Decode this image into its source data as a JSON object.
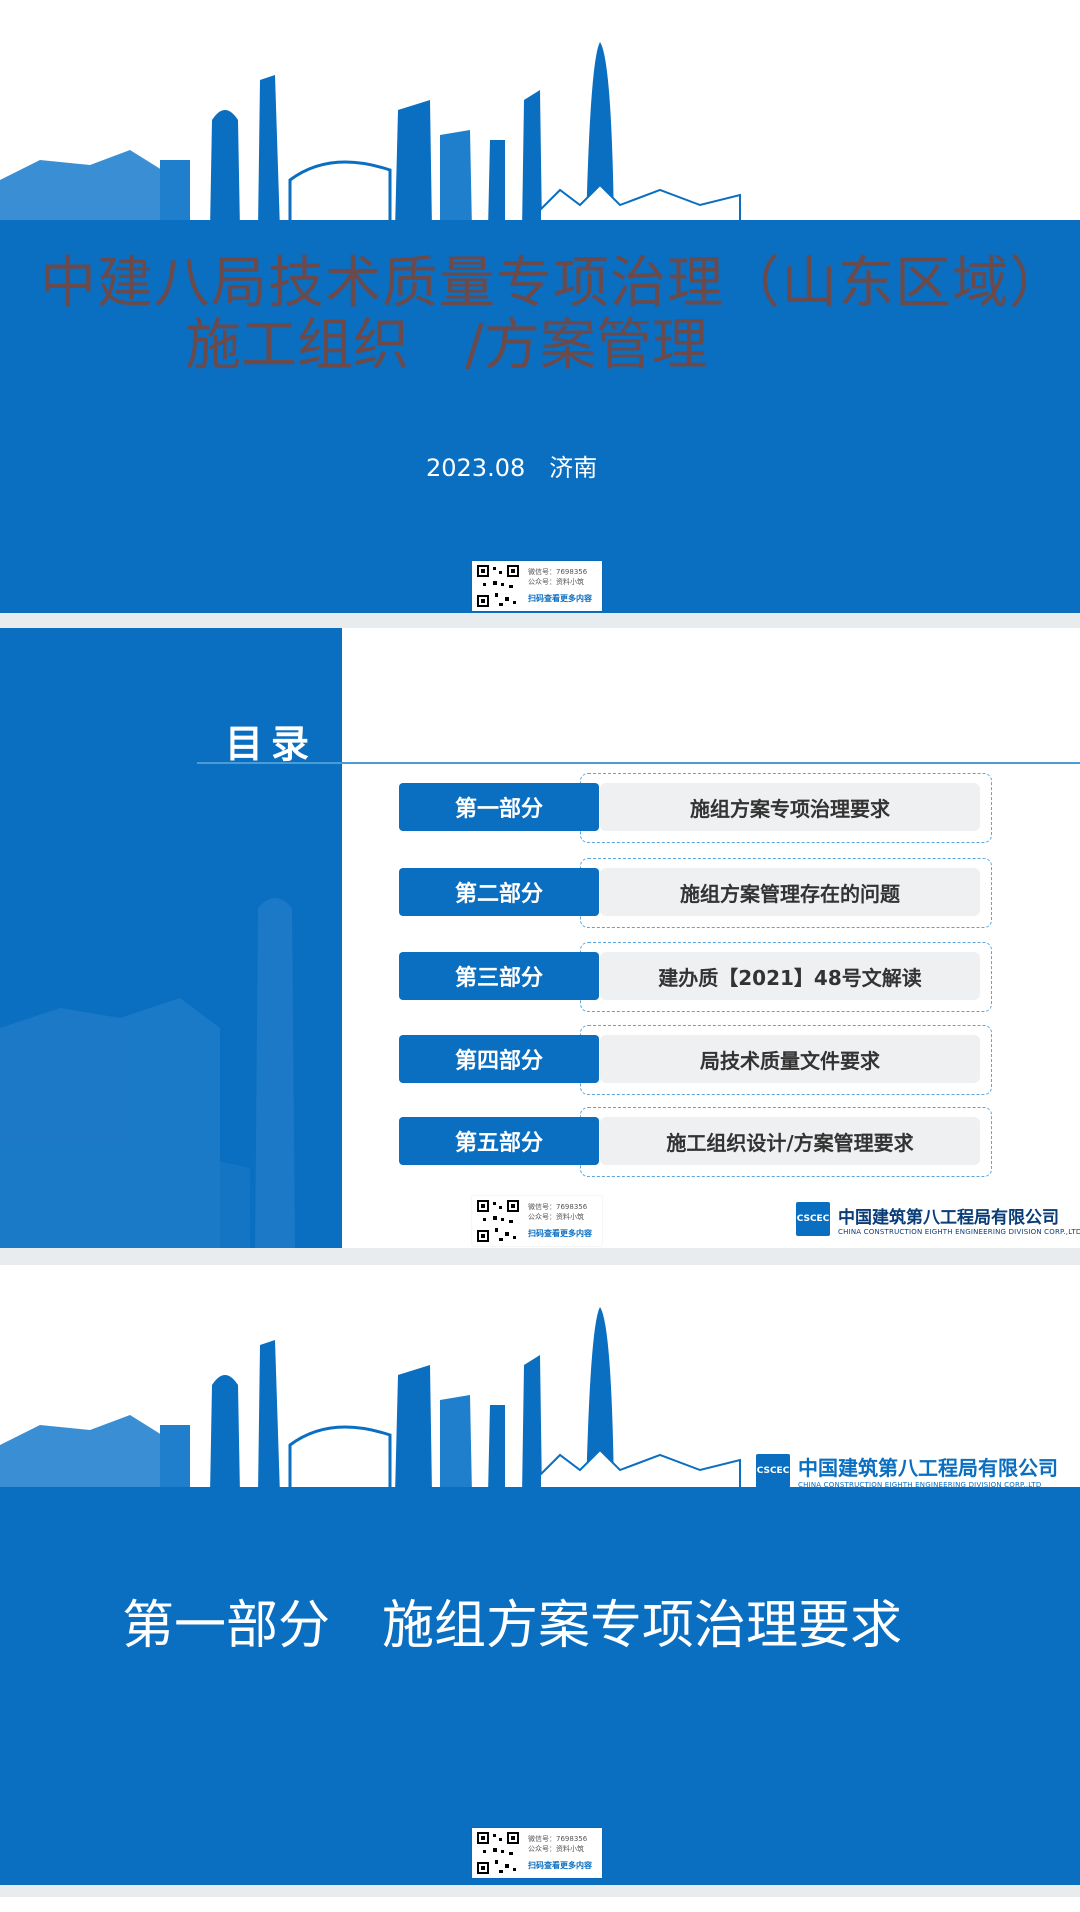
{
  "slide1": {
    "title_line1": "中建八局技术质量专项治理（山东区域）",
    "title_line2": "施工组织　/方案管理",
    "date_place": "2023.08　济南"
  },
  "qr": {
    "line1": "微信号：7698356",
    "line2": "公众号：资料小筑",
    "line3": "扫码查看更多内容"
  },
  "slide2": {
    "toc_title": "目录",
    "items": [
      {
        "tag": "第一部分",
        "desc": "施组方案专项治理要求"
      },
      {
        "tag": "第二部分",
        "desc": "施组方案管理存在的问题"
      },
      {
        "tag": "第三部分",
        "desc": "建办质【2021】48号文解读"
      },
      {
        "tag": "第四部分",
        "desc": "局技术质量文件要求"
      },
      {
        "tag": "第五部分",
        "desc": "施工组织设计/方案管理要求"
      }
    ]
  },
  "company": {
    "cn": "中国建筑第八工程局有限公司",
    "en": "CHINA CONSTRUCTION EIGHTH ENGINEERING DIVISION CORP.,LTD",
    "logo_text": "CSCEC"
  },
  "slide3": {
    "section_title": "第一部分　施组方案专项治理要求"
  },
  "colors": {
    "brand_blue": "#0a6ec1",
    "title_brown": "#6b4a4c"
  }
}
